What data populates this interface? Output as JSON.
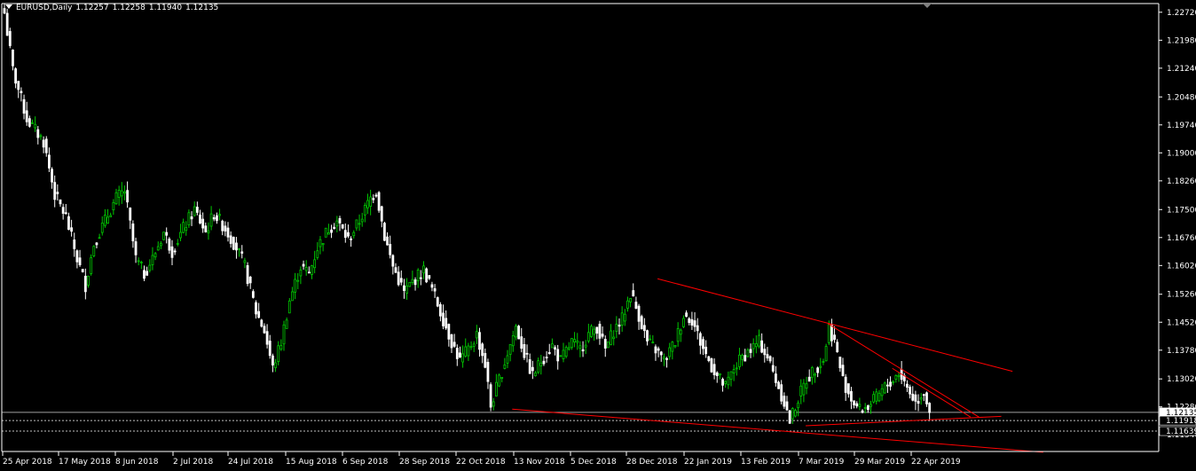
{
  "header": {
    "symbol": "EURUSD,Daily",
    "open": "1.12257",
    "high": "1.12258",
    "low": "1.11940",
    "close": "1.12135"
  },
  "colors": {
    "background": "#000000",
    "axis": "#ffffff",
    "bull_candle": "#00c800",
    "bear_candle": "#ffffff",
    "trendline": "#ff0000",
    "level_line": "#c0c0c0"
  },
  "chart_data": {
    "type": "candlestick",
    "symbol": "EURUSD",
    "timeframe": "Daily",
    "ylim": [
      1.111,
      1.2295
    ],
    "y_ticks": [
      "1.22720",
      "1.21980",
      "1.21240",
      "1.20480",
      "1.19740",
      "1.19000",
      "1.18260",
      "1.17500",
      "1.16760",
      "1.16020",
      "1.15260",
      "1.14520",
      "1.13780",
      "1.13020",
      "1.12280",
      "1.11540"
    ],
    "price_tags": [
      "1.12135",
      "1.11918",
      "1.11639"
    ],
    "x_labels": [
      "25 Apr 2018",
      "17 May 2018",
      "8 Jun 2018",
      "2 Jul 2018",
      "24 Jul 2018",
      "15 Aug 2018",
      "6 Sep 2018",
      "28 Sep 2018",
      "22 Oct 2018",
      "13 Nov 2018",
      "5 Dec 2018",
      "28 Dec 2018",
      "22 Jan 2019",
      "13 Feb 2019",
      "7 Mar 2019",
      "29 Mar 2019",
      "22 Apr 2019"
    ],
    "anchors": [
      {
        "i": 0,
        "c": 1.227
      },
      {
        "i": 3,
        "c": 1.212
      },
      {
        "i": 8,
        "c": 1.199
      },
      {
        "i": 14,
        "c": 1.193
      },
      {
        "i": 18,
        "c": 1.179
      },
      {
        "i": 22,
        "c": 1.173
      },
      {
        "i": 26,
        "c": 1.162
      },
      {
        "i": 29,
        "c": 1.155
      },
      {
        "i": 32,
        "c": 1.166
      },
      {
        "i": 36,
        "c": 1.172
      },
      {
        "i": 40,
        "c": 1.178
      },
      {
        "i": 43,
        "c": 1.18
      },
      {
        "i": 47,
        "c": 1.162
      },
      {
        "i": 50,
        "c": 1.158
      },
      {
        "i": 53,
        "c": 1.162
      },
      {
        "i": 57,
        "c": 1.169
      },
      {
        "i": 60,
        "c": 1.164
      },
      {
        "i": 64,
        "c": 1.17
      },
      {
        "i": 68,
        "c": 1.175
      },
      {
        "i": 72,
        "c": 1.169
      },
      {
        "i": 75,
        "c": 1.174
      },
      {
        "i": 79,
        "c": 1.17
      },
      {
        "i": 83,
        "c": 1.165
      },
      {
        "i": 86,
        "c": 1.16
      },
      {
        "i": 90,
        "c": 1.148
      },
      {
        "i": 93,
        "c": 1.143
      },
      {
        "i": 96,
        "c": 1.133
      },
      {
        "i": 99,
        "c": 1.14
      },
      {
        "i": 102,
        "c": 1.151
      },
      {
        "i": 106,
        "c": 1.16
      },
      {
        "i": 109,
        "c": 1.158
      },
      {
        "i": 112,
        "c": 1.165
      },
      {
        "i": 116,
        "c": 1.17
      },
      {
        "i": 119,
        "c": 1.172
      },
      {
        "i": 123,
        "c": 1.167
      },
      {
        "i": 127,
        "c": 1.172
      },
      {
        "i": 131,
        "c": 1.178
      },
      {
        "i": 133,
        "c": 1.18
      },
      {
        "i": 136,
        "c": 1.168
      },
      {
        "i": 139,
        "c": 1.16
      },
      {
        "i": 143,
        "c": 1.153
      },
      {
        "i": 146,
        "c": 1.156
      },
      {
        "i": 150,
        "c": 1.159
      },
      {
        "i": 153,
        "c": 1.154
      },
      {
        "i": 156,
        "c": 1.148
      },
      {
        "i": 160,
        "c": 1.14
      },
      {
        "i": 163,
        "c": 1.135
      },
      {
        "i": 166,
        "c": 1.138
      },
      {
        "i": 169,
        "c": 1.142
      },
      {
        "i": 172,
        "c": 1.134
      },
      {
        "i": 174,
        "c": 1.123
      },
      {
        "i": 177,
        "c": 1.13
      },
      {
        "i": 180,
        "c": 1.137
      },
      {
        "i": 183,
        "c": 1.144
      },
      {
        "i": 186,
        "c": 1.137
      },
      {
        "i": 189,
        "c": 1.131
      },
      {
        "i": 192,
        "c": 1.135
      },
      {
        "i": 196,
        "c": 1.139
      },
      {
        "i": 199,
        "c": 1.135
      },
      {
        "i": 203,
        "c": 1.14
      },
      {
        "i": 206,
        "c": 1.138
      },
      {
        "i": 209,
        "c": 1.142
      },
      {
        "i": 212,
        "c": 1.144
      },
      {
        "i": 215,
        "c": 1.138
      },
      {
        "i": 218,
        "c": 1.143
      },
      {
        "i": 221,
        "c": 1.146
      },
      {
        "i": 224,
        "c": 1.153
      },
      {
        "i": 227,
        "c": 1.147
      },
      {
        "i": 230,
        "c": 1.14
      },
      {
        "i": 233,
        "c": 1.138
      },
      {
        "i": 236,
        "c": 1.135
      },
      {
        "i": 240,
        "c": 1.14
      },
      {
        "i": 243,
        "c": 1.147
      },
      {
        "i": 246,
        "c": 1.146
      },
      {
        "i": 249,
        "c": 1.14
      },
      {
        "i": 252,
        "c": 1.135
      },
      {
        "i": 255,
        "c": 1.131
      },
      {
        "i": 258,
        "c": 1.128
      },
      {
        "i": 261,
        "c": 1.133
      },
      {
        "i": 264,
        "c": 1.136
      },
      {
        "i": 267,
        "c": 1.138
      },
      {
        "i": 270,
        "c": 1.14
      },
      {
        "i": 273,
        "c": 1.136
      },
      {
        "i": 276,
        "c": 1.13
      },
      {
        "i": 279,
        "c": 1.124
      },
      {
        "i": 281,
        "c": 1.119
      },
      {
        "i": 284,
        "c": 1.125
      },
      {
        "i": 287,
        "c": 1.13
      },
      {
        "i": 290,
        "c": 1.133
      },
      {
        "i": 293,
        "c": 1.135
      },
      {
        "i": 295,
        "c": 1.144
      },
      {
        "i": 297,
        "c": 1.14
      },
      {
        "i": 300,
        "c": 1.13
      },
      {
        "i": 303,
        "c": 1.125
      },
      {
        "i": 306,
        "c": 1.122
      },
      {
        "i": 309,
        "c": 1.123
      },
      {
        "i": 312,
        "c": 1.125
      },
      {
        "i": 315,
        "c": 1.128
      },
      {
        "i": 318,
        "c": 1.13
      },
      {
        "i": 320,
        "c": 1.132
      },
      {
        "i": 323,
        "c": 1.128
      },
      {
        "i": 326,
        "c": 1.124
      },
      {
        "i": 329,
        "c": 1.127
      },
      {
        "i": 331,
        "c": 1.1213
      }
    ],
    "trendlines": [
      {
        "from": {
          "i": 234,
          "p": 1.1567
        },
        "to": {
          "i": 361,
          "p": 1.1322
        }
      },
      {
        "from": {
          "i": 295,
          "p": 1.1448
        },
        "to": {
          "i": 349,
          "p": 1.1201
        }
      },
      {
        "from": {
          "i": 318,
          "p": 1.133
        },
        "to": {
          "i": 346,
          "p": 1.1201
        }
      },
      {
        "from": {
          "i": 182,
          "p": 1.1222
        },
        "to": {
          "i": 372,
          "p": 1.1108
        }
      },
      {
        "from": {
          "i": 287,
          "p": 1.1178
        },
        "to": {
          "i": 357,
          "p": 1.1203
        }
      }
    ],
    "levels": [
      1.12135,
      1.11918,
      1.11639
    ],
    "grid": false,
    "legend": "none"
  }
}
